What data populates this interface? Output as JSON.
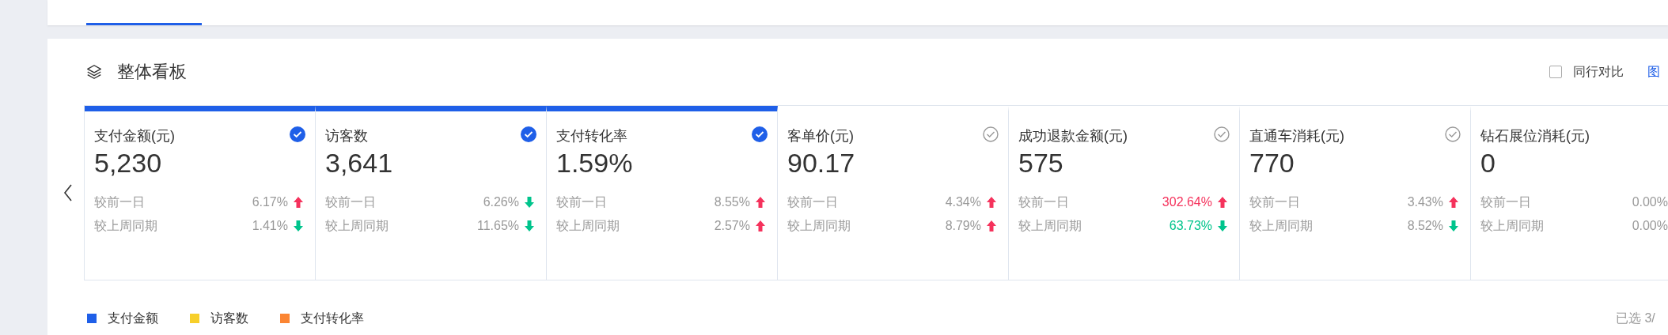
{
  "board": {
    "title": "整体看板",
    "peer_compare": {
      "label": "同行对比",
      "checked": false
    },
    "chart_link": "图",
    "cards": [
      {
        "title": "支付金额(元)",
        "value": "5,230",
        "selected": true,
        "stats": [
          {
            "label": "较前一日",
            "value": "6.17%",
            "up": true,
            "highlight": false
          },
          {
            "label": "较上周同期",
            "value": "1.41%",
            "up": false,
            "highlight": false
          }
        ]
      },
      {
        "title": "访客数",
        "value": "3,641",
        "selected": true,
        "stats": [
          {
            "label": "较前一日",
            "value": "6.26%",
            "up": false,
            "highlight": false
          },
          {
            "label": "较上周同期",
            "value": "11.65%",
            "up": false,
            "highlight": false
          }
        ]
      },
      {
        "title": "支付转化率",
        "value": "1.59%",
        "selected": true,
        "stats": [
          {
            "label": "较前一日",
            "value": "8.55%",
            "up": true,
            "highlight": false
          },
          {
            "label": "较上周同期",
            "value": "2.57%",
            "up": true,
            "highlight": false
          }
        ]
      },
      {
        "title": "客单价(元)",
        "value": "90.17",
        "selected": false,
        "stats": [
          {
            "label": "较前一日",
            "value": "4.34%",
            "up": true,
            "highlight": false
          },
          {
            "label": "较上周同期",
            "value": "8.79%",
            "up": true,
            "highlight": false
          }
        ]
      },
      {
        "title": "成功退款金额(元)",
        "value": "575",
        "selected": false,
        "stats": [
          {
            "label": "较前一日",
            "value": "302.64%",
            "up": true,
            "highlight": true
          },
          {
            "label": "较上周同期",
            "value": "63.73%",
            "up": false,
            "highlight": true
          }
        ]
      },
      {
        "title": "直通车消耗(元)",
        "value": "770",
        "selected": false,
        "stats": [
          {
            "label": "较前一日",
            "value": "3.43%",
            "up": true,
            "highlight": false
          },
          {
            "label": "较上周同期",
            "value": "8.52%",
            "up": false,
            "highlight": false
          }
        ]
      },
      {
        "title": "钻石展位消耗(元)",
        "value": "0",
        "stats": [
          {
            "label": "较前一日",
            "value": "0.00%",
            "highlight": false
          },
          {
            "label": "较上周同期",
            "value": "0.00%",
            "highlight": false
          }
        ]
      }
    ],
    "legend": [
      {
        "label": "支付金额",
        "color": "#1f5fe8"
      },
      {
        "label": "访客数",
        "color": "#f7cf2a"
      },
      {
        "label": "支付转化率",
        "color": "#fb8533"
      }
    ],
    "selected_count": "已选 3/"
  }
}
